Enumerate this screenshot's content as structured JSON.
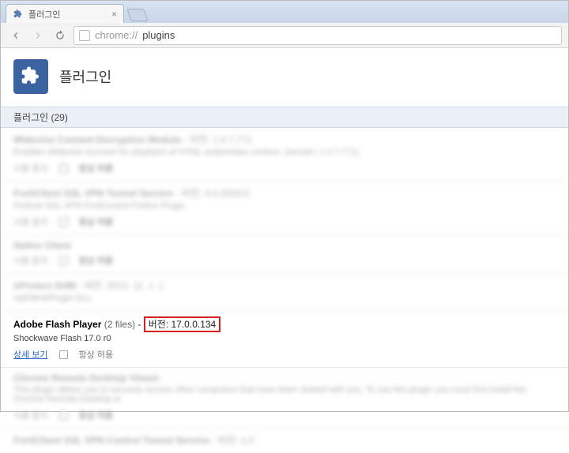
{
  "tab": {
    "title": "플러그인"
  },
  "address": {
    "scheme": "chrome://",
    "path": "plugins"
  },
  "header": {
    "title": "플러그인"
  },
  "countbar": {
    "label": "플러그인",
    "count": "(29)"
  },
  "actions": {
    "disable": "사용 중지",
    "always": "항상 허용",
    "more": "상세 보기"
  },
  "plugins": [
    {
      "name": "Widevine Content Decryption Module",
      "meta": "- 버전: 1.4.7.771",
      "desc": "Enables Widevine licenses for playback of HTML audio/video content. (version: 1.4.7.771)"
    },
    {
      "name": "FortiClient SSL VPN Tunnel Service",
      "meta": "- 버전: 4.0.2020.0",
      "desc": "Fortinet SSL VPN FortiControl Firefox Plugin"
    },
    {
      "name": "Native Client",
      "meta": "",
      "desc": ""
    },
    {
      "name": "nProtect SUM",
      "meta": "- 버전: 2013. 11. 1. 1",
      "desc": "npENKWPlugin DLL"
    }
  ],
  "flash": {
    "name": "Adobe Flash Player",
    "files": "(2 files)",
    "version_label": "버전: 17.0.0.134",
    "desc": "Shockwave Flash 17.0 r0"
  },
  "tail": [
    {
      "name": "Chrome Remote Desktop Viewer",
      "meta": "",
      "desc": "This plugin allows you to securely access other computers that have been shared with you. To use this plugin you must first install the Chrome Remote Desktop w"
    },
    {
      "name": "FortiClient SSL VPN Control Tunnel Service",
      "meta": "- 버전: 1.0",
      "desc": ""
    }
  ]
}
